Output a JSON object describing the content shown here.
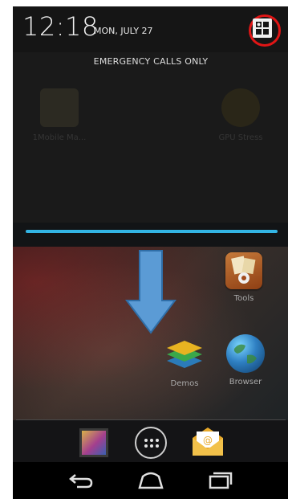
{
  "status": {
    "time": "12:18",
    "date": "MON, JULY 27",
    "network_status": "EMERGENCY CALLS ONLY",
    "settings_icon": "quick-settings-icon"
  },
  "shade_apps": [
    {
      "label": "1Mobile Ma..."
    },
    {
      "label": "GPU Stress"
    }
  ],
  "home_apps": [
    {
      "label": "Tools",
      "icon": "tools-icon"
    },
    {
      "label": "Demos",
      "icon": "demos-icon"
    },
    {
      "label": "Browser",
      "icon": "browser-icon"
    }
  ],
  "dock": [
    {
      "icon": "gallery-icon"
    },
    {
      "icon": "all-apps-icon"
    },
    {
      "icon": "email-icon"
    }
  ],
  "navbar": [
    {
      "icon": "back-icon"
    },
    {
      "icon": "home-icon"
    },
    {
      "icon": "recent-apps-icon"
    }
  ],
  "colors": {
    "handle": "#33b5e5",
    "arrow": "#5b9bd5",
    "highlight_ring": "#e01515"
  }
}
